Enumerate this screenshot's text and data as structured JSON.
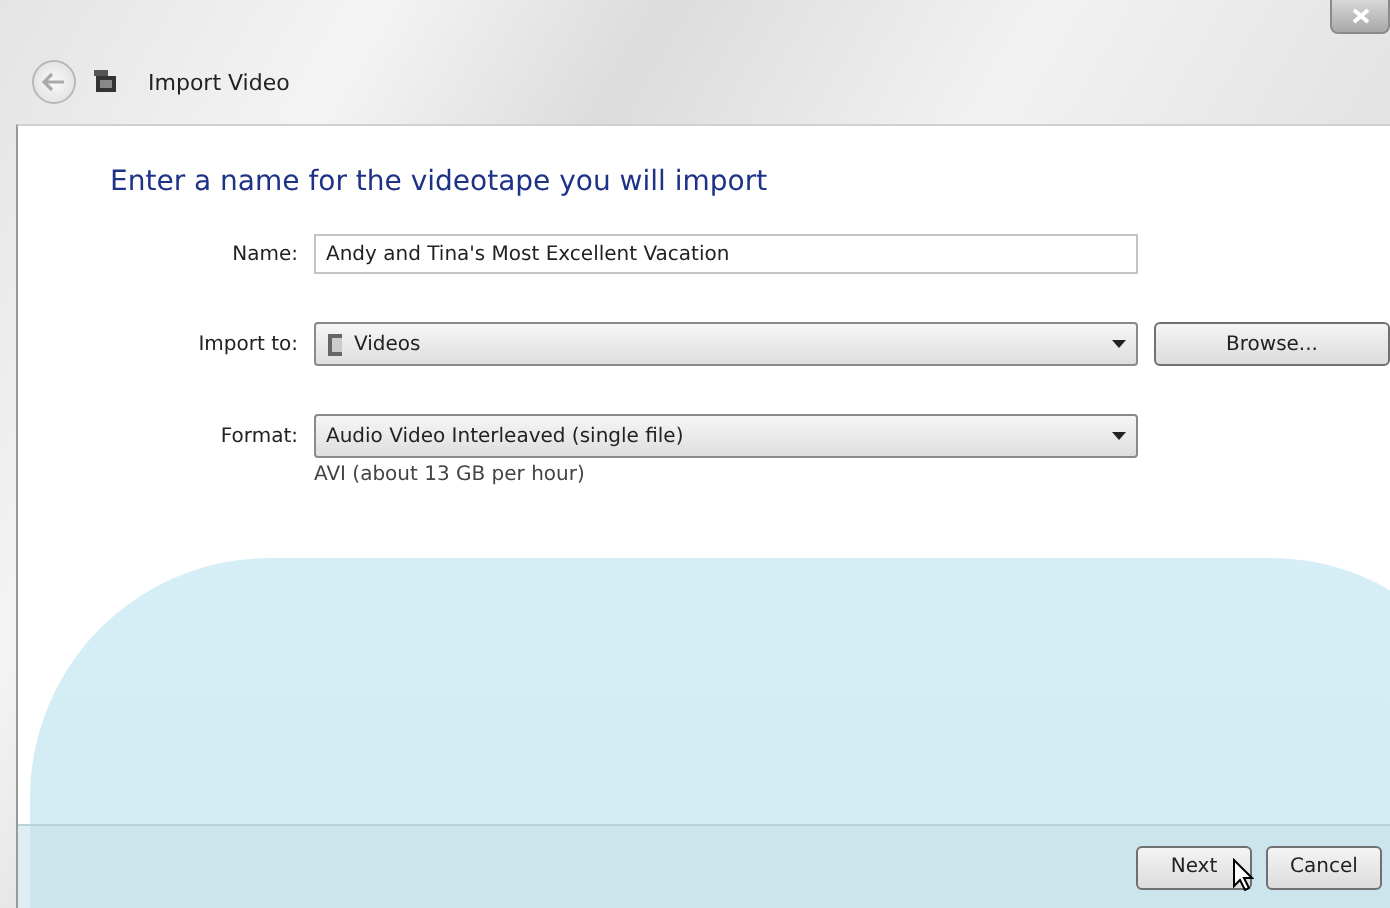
{
  "window": {
    "title": "Import Video"
  },
  "heading": "Enter a name for the videotape you will import",
  "name_field": {
    "label": "Name:",
    "value": "Andy and Tina's Most Excellent Vacation"
  },
  "import_to": {
    "label": "Import to:",
    "value": "Videos",
    "button": "Browse..."
  },
  "format": {
    "label": "Format:",
    "value": "Audio Video Interleaved (single file)",
    "hint": "AVI (about 13 GB per hour)"
  },
  "buttons": [
    "Next",
    "Cancel"
  ]
}
